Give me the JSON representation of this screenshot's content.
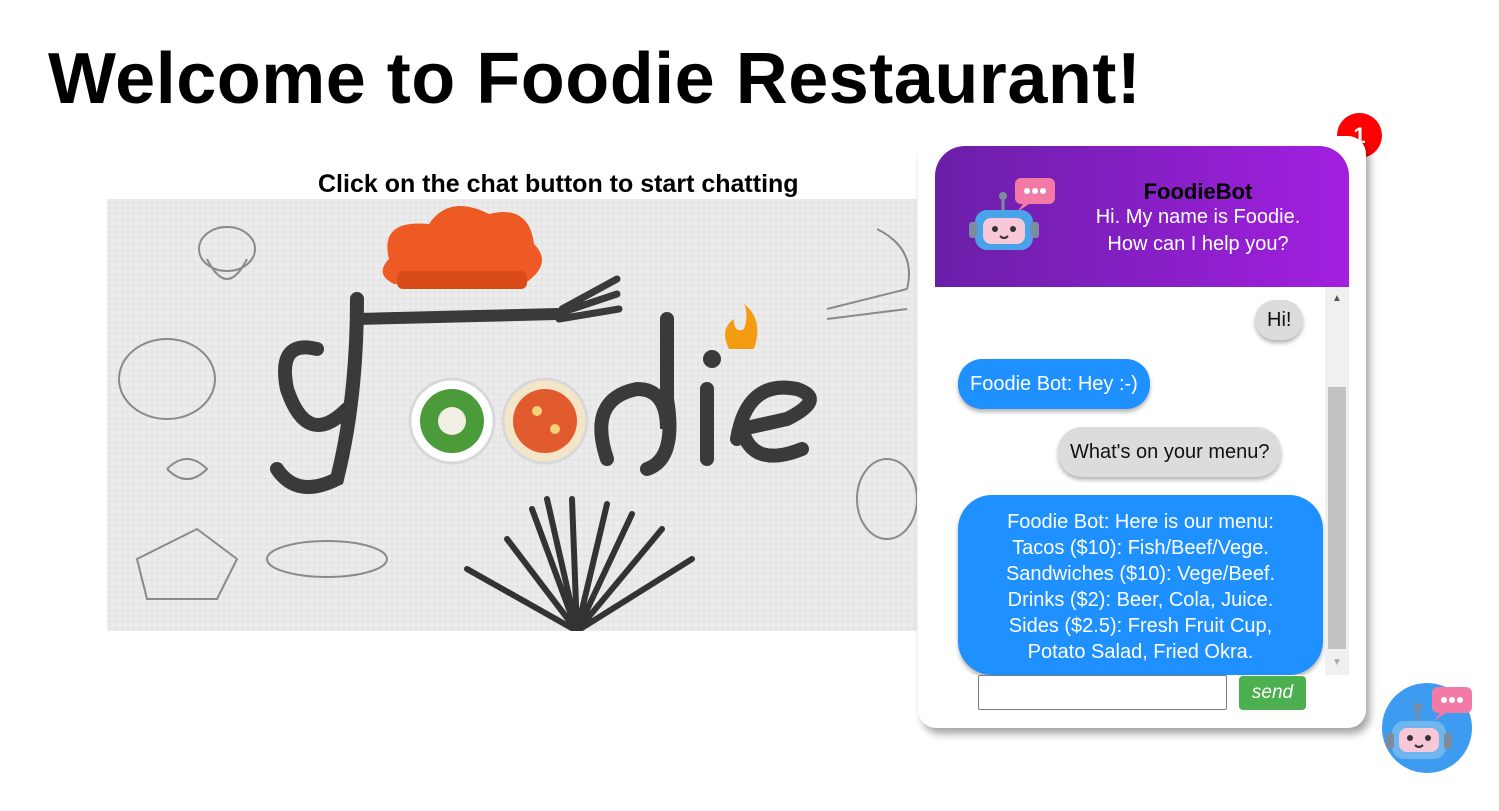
{
  "page": {
    "title": "Welcome to Foodie Restaurant!",
    "subtitle": "Click on the chat button to start chatting",
    "hero_logo_text": "Foodie"
  },
  "chat": {
    "bot_name": "FoodieBot",
    "greeting_line1": "Hi. My name is Foodie.",
    "greeting_line2": "How can I help you?",
    "messages": [
      {
        "sender": "user",
        "lines": [
          "Hi!"
        ]
      },
      {
        "sender": "bot",
        "lines": [
          "Foodie Bot: Hey :-)"
        ]
      },
      {
        "sender": "user",
        "lines": [
          "What's on your menu?"
        ]
      },
      {
        "sender": "bot",
        "lines": [
          "Foodie Bot: Here is our menu:",
          "Tacos ($10): Fish/Beef/Vege.",
          "Sandwiches ($10): Vege/Beef.",
          "Drinks ($2): Beer, Cola, Juice.",
          "Sides ($2.5): Fresh Fruit Cup,",
          "Potato Salad, Fried Okra."
        ]
      }
    ],
    "input_value": "",
    "send_label": "send",
    "notification_count": "1"
  },
  "icons": {
    "avatar": "robot-chat-icon",
    "fab": "robot-chat-icon",
    "scroll_up": "scroll-up-arrow-icon",
    "scroll_down": "scroll-down-arrow-icon"
  },
  "colors": {
    "header_start": "#6a1fa8",
    "header_end": "#a21fe0",
    "bot_bubble": "#1e90ff",
    "user_bubble": "#dcdcdc",
    "send_button": "#4caf50",
    "badge": "#ff0000",
    "fab": "#3d9cf0"
  }
}
